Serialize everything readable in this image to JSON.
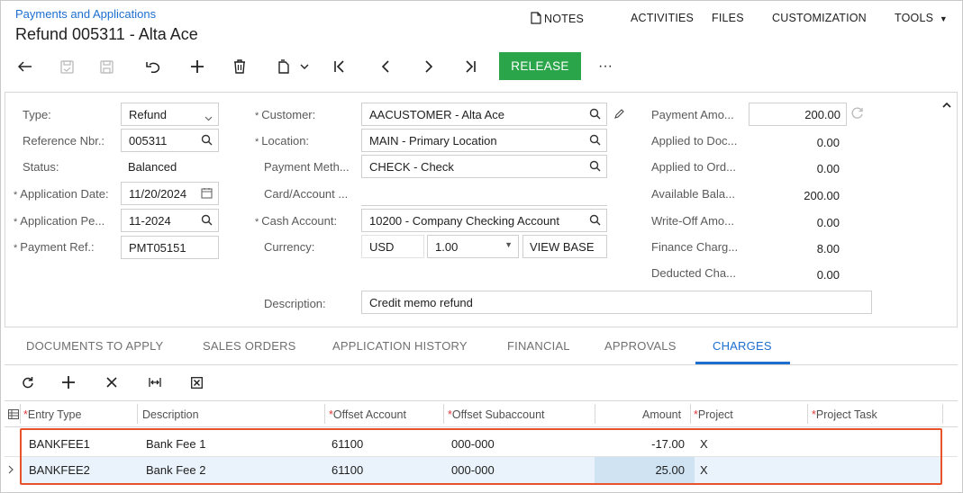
{
  "header": {
    "breadcrumb": "Payments and Applications",
    "title": "Refund 005311 - Alta Ace",
    "menu": {
      "notes": "NOTES",
      "activities": "ACTIVITIES",
      "files": "FILES",
      "customization": "CUSTOMIZATION",
      "tools": "TOOLS"
    }
  },
  "toolbar": {
    "release": "RELEASE",
    "more": "···"
  },
  "form": {
    "left": {
      "type_label": "Type:",
      "type_value": "Refund",
      "ref_label": "Reference Nbr.:",
      "ref_value": "005311",
      "status_label": "Status:",
      "status_value": "Balanced",
      "app_date_label": "Application Date:",
      "app_date_value": "11/20/2024",
      "app_period_label": "Application Pe...",
      "app_period_value": "11-2024",
      "payment_ref_label": "Payment Ref.:",
      "payment_ref_value": "PMT05151"
    },
    "middle": {
      "customer_label": "Customer:",
      "customer_value": "AACUSTOMER - Alta Ace",
      "location_label": "Location:",
      "location_value": "MAIN - Primary Location",
      "payment_method_label": "Payment Meth...",
      "payment_method_value": "CHECK - Check",
      "card_account_label": "Card/Account ...",
      "cash_account_label": "Cash Account:",
      "cash_account_value": "10200 - Company Checking Account",
      "currency_label": "Currency:",
      "currency_value": "USD",
      "currency_rate": "1.00",
      "view_base": "VIEW BASE",
      "description_label": "Description:",
      "description_value": "Credit memo refund"
    },
    "right": {
      "payment_amount_label": "Payment Amo...",
      "payment_amount_value": "200.00",
      "applied_doc_label": "Applied to Doc...",
      "applied_doc_value": "0.00",
      "applied_ord_label": "Applied to Ord...",
      "applied_ord_value": "0.00",
      "available_label": "Available Bala...",
      "available_value": "200.00",
      "writeoff_label": "Write-Off Amo...",
      "writeoff_value": "0.00",
      "finance_label": "Finance Charg...",
      "finance_value": "8.00",
      "deducted_label": "Deducted Cha...",
      "deducted_value": "0.00"
    }
  },
  "tabs": [
    {
      "label": "DOCUMENTS TO APPLY"
    },
    {
      "label": "SALES ORDERS"
    },
    {
      "label": "APPLICATION HISTORY"
    },
    {
      "label": "FINANCIAL"
    },
    {
      "label": "APPROVALS"
    },
    {
      "label": "CHARGES"
    }
  ],
  "grid": {
    "headers": {
      "entry_type": "Entry Type",
      "description": "Description",
      "offset_account": "Offset Account",
      "offset_subaccount": "Offset Subaccount",
      "amount": "Amount",
      "project": "Project",
      "project_task": "Project Task"
    },
    "rows": [
      {
        "entry_type": "BANKFEE1",
        "description": "Bank Fee 1",
        "offset_account": "61100",
        "offset_subaccount": "000-000",
        "amount": "-17.00",
        "project": "X"
      },
      {
        "entry_type": "BANKFEE2",
        "description": "Bank Fee 2",
        "offset_account": "61100",
        "offset_subaccount": "000-000",
        "amount": "25.00",
        "project": "X"
      }
    ]
  },
  "colors": {
    "accent": "#1d6fcf",
    "release": "#2aa54a",
    "highlight": "#e8532b"
  }
}
